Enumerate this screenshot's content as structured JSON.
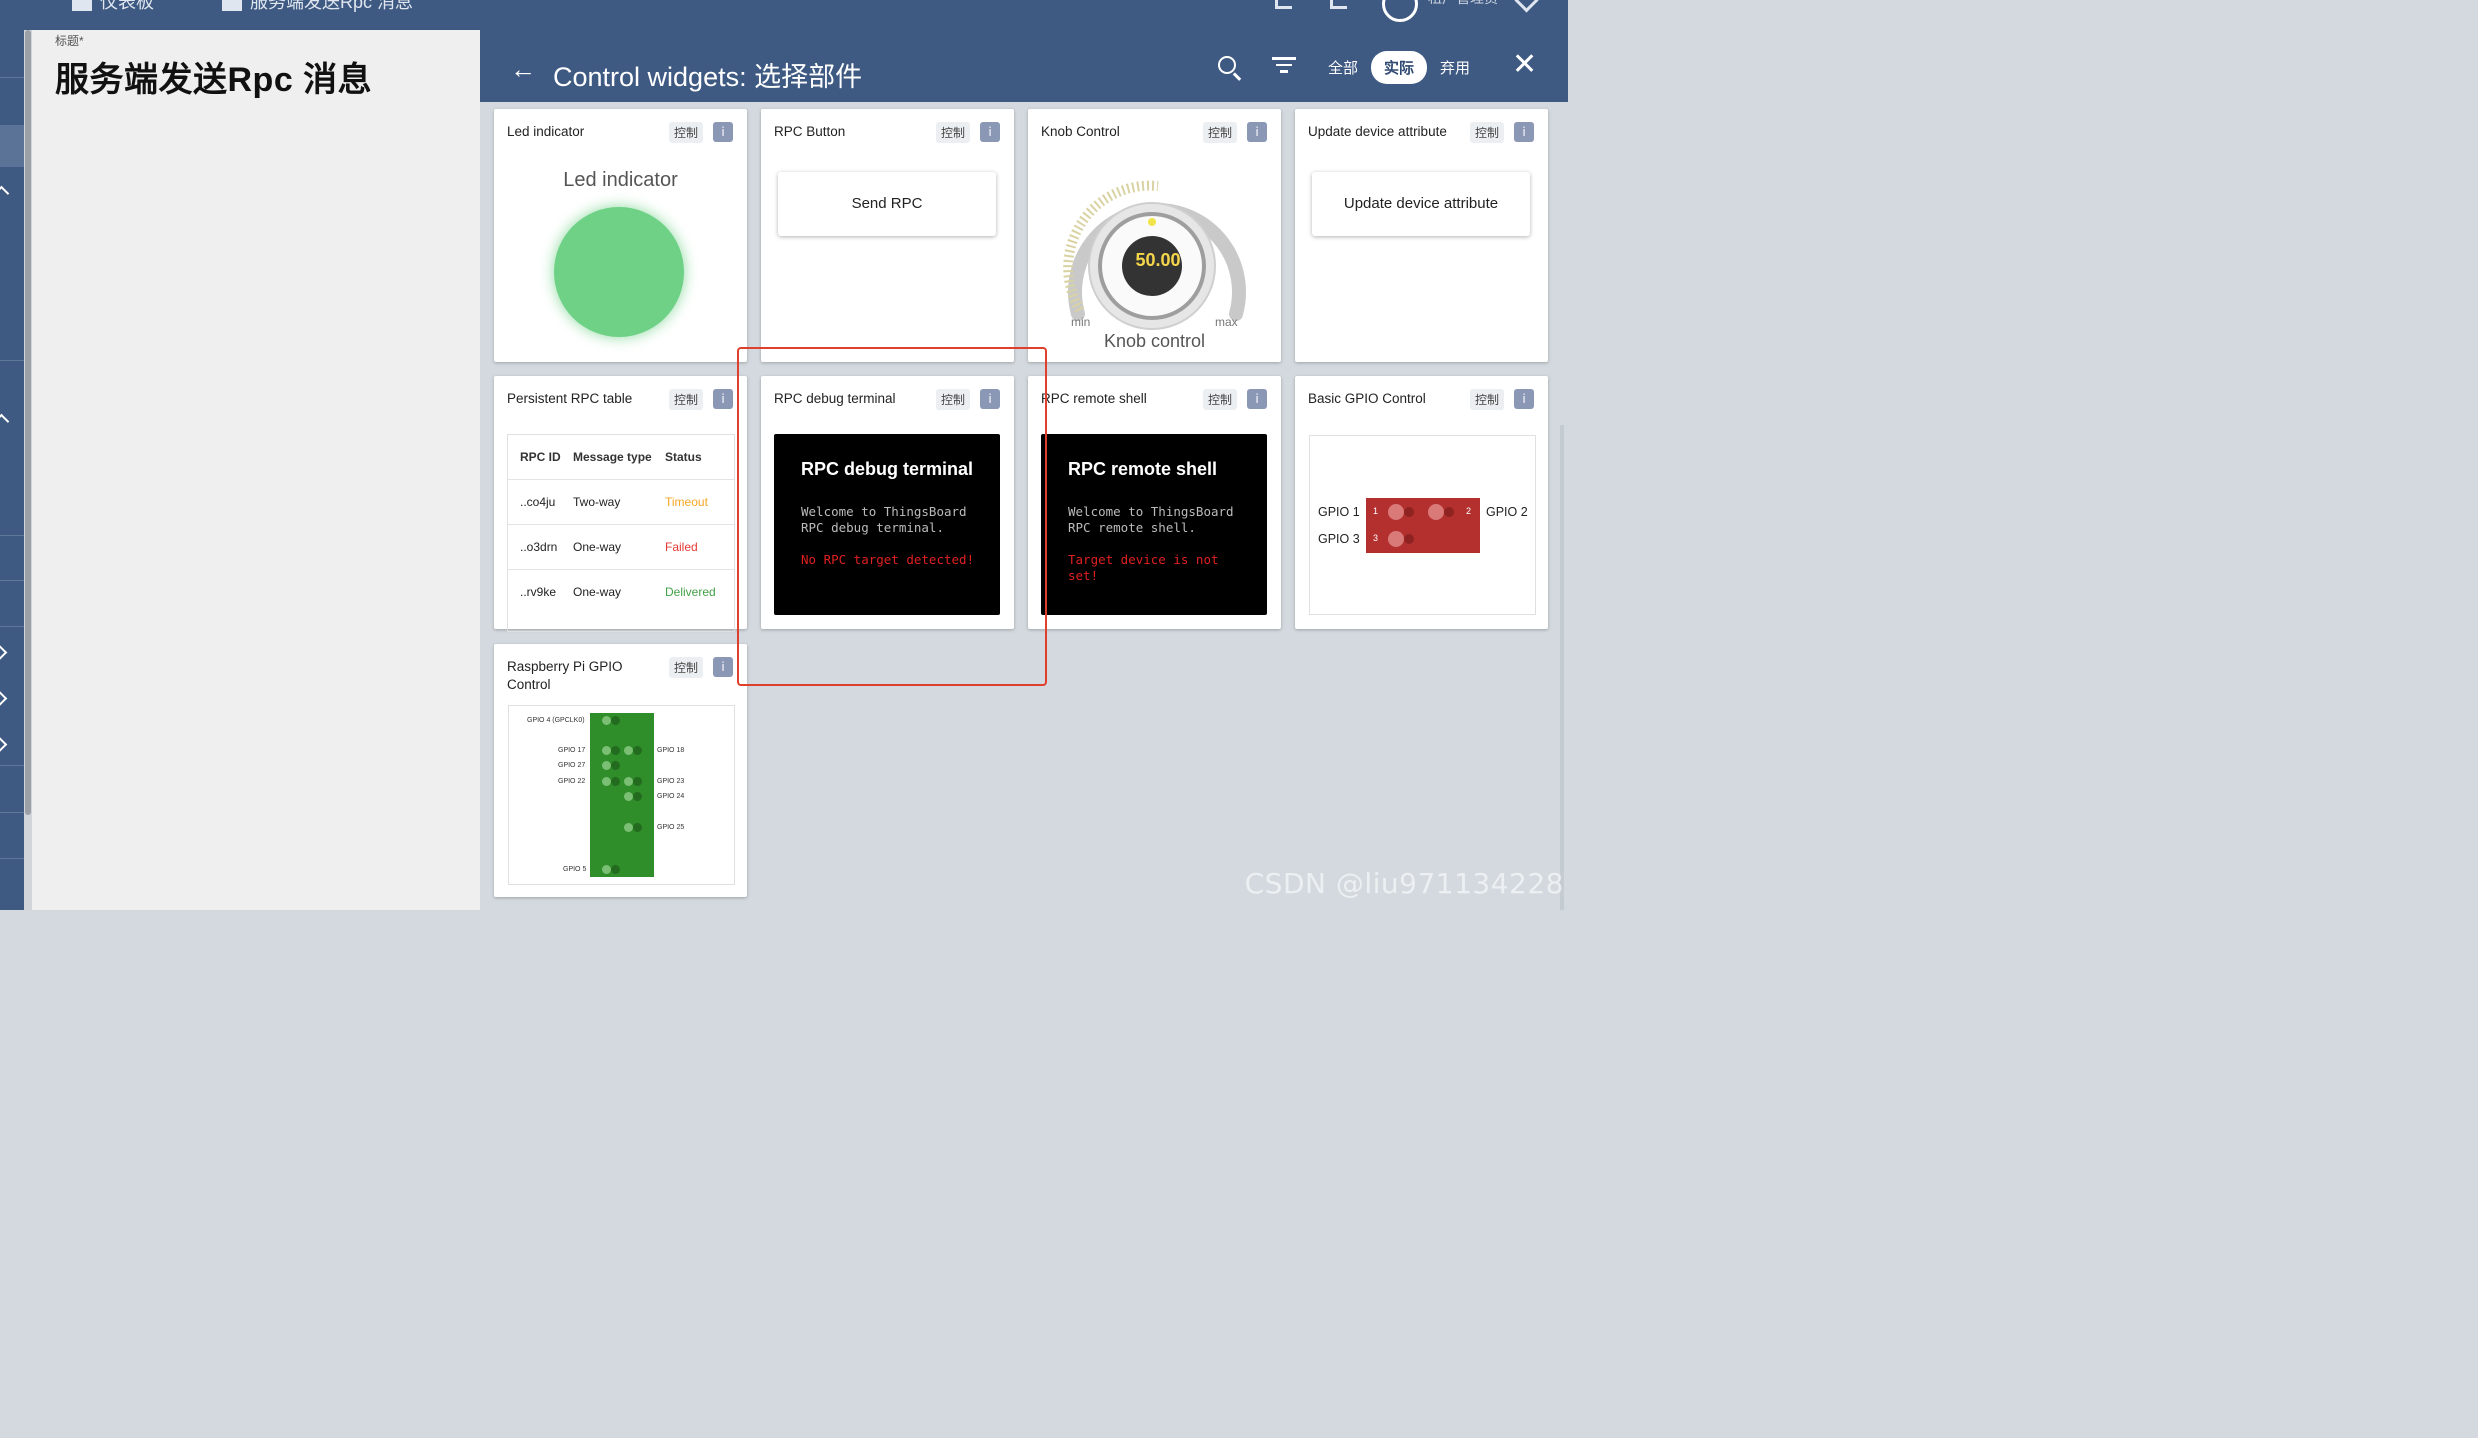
{
  "topbar": {
    "crumb1": "仪表板",
    "crumb2": "服务端发送Rpc 消息",
    "user_role": "租户管理员"
  },
  "left_panel": {
    "field_label": "标题*",
    "title_value": "服务端发送Rpc 消息"
  },
  "dialog": {
    "back_icon": "←",
    "title": "Control widgets: 选择部件",
    "tabs": [
      "全部",
      "实际",
      "弃用"
    ],
    "active_tab": "实际",
    "close_icon": "✕"
  },
  "common": {
    "ctrl_badge": "控制",
    "info_badge": "i"
  },
  "widgets": {
    "led": {
      "title": "Led indicator",
      "display_title": "Led indicator",
      "color": "#6ed186"
    },
    "rpc_button": {
      "title": "RPC Button",
      "button_label": "Send RPC"
    },
    "knob": {
      "title": "Knob Control",
      "value": "50.00",
      "min": "min",
      "max": "max",
      "label": "Knob control"
    },
    "update_attr": {
      "title": "Update device attribute",
      "button_label": "Update device attribute"
    },
    "persistent_table": {
      "title": "Persistent RPC table",
      "columns": [
        "RPC ID",
        "Message type",
        "Status"
      ],
      "rows": [
        {
          "id": "..co4ju",
          "type": "Two-way",
          "status": "Timeout",
          "color": "#f5a623"
        },
        {
          "id": "..o3drn",
          "type": "One-way",
          "status": "Failed",
          "color": "#e53935"
        },
        {
          "id": "..rv9ke",
          "type": "One-way",
          "status": "Delivered",
          "color": "#43a047"
        }
      ]
    },
    "debug_terminal": {
      "title": "RPC debug terminal",
      "term_title": "RPC debug terminal",
      "term_welcome": "Welcome to ThingsBoard\nRPC debug terminal.",
      "term_error": "No RPC target detected!"
    },
    "remote_shell": {
      "title": "RPC remote shell",
      "term_title": "RPC remote shell",
      "term_welcome": "Welcome to ThingsBoard\nRPC remote shell.",
      "term_error": "Target device is not\nset!"
    },
    "basic_gpio": {
      "title": "Basic GPIO Control",
      "labels": [
        "GPIO 1",
        "GPIO 2",
        "GPIO 3"
      ],
      "pins": [
        "1",
        "2",
        "3"
      ]
    },
    "rpi_gpio": {
      "title": "Raspberry Pi GPIO\nControl",
      "left_labels": [
        "GPIO 4 (GPCLK0)",
        "GPIO 17",
        "GPIO 27",
        "GPIO 22",
        "GPIO 5"
      ],
      "right_labels": [
        "GPIO 18",
        "GPIO 23",
        "GPIO 24",
        "GPIO 25"
      ]
    }
  },
  "watermark": "CSDN @liu971134228"
}
